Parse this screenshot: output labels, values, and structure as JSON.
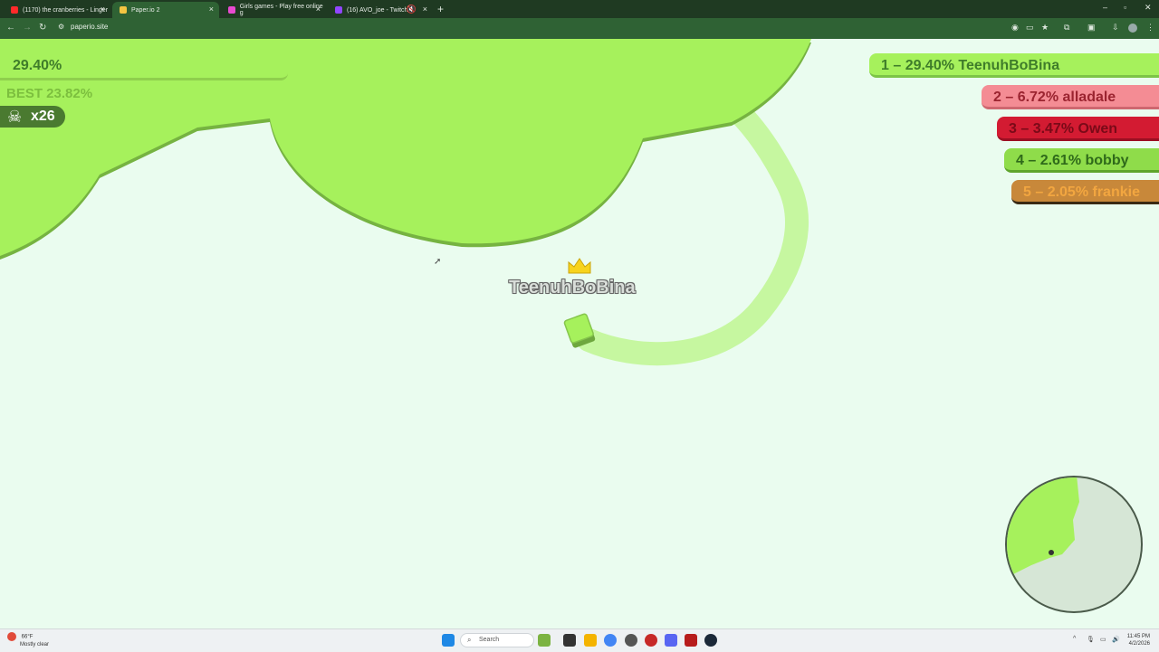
{
  "browser": {
    "tabs": [
      {
        "title": "(1170) the cranberries - Linger",
        "color": "#ff2a2a"
      },
      {
        "title": "Paper.io 2",
        "color": "#f4c542",
        "active": true
      },
      {
        "title": "Girls games - Play free online g",
        "color": "#e84ad1"
      },
      {
        "title": "(16) AVO_joe - Twitch",
        "color": "#9146ff"
      }
    ],
    "new_tab": "+",
    "url": "paperio.site"
  },
  "hud": {
    "percent": "29.40%",
    "best": "BEST 23.82%",
    "kills": "x26"
  },
  "leaderboard": [
    {
      "rank_text": "1 – 29.40% TeenuhBoBina",
      "bg": "#a6f15c",
      "border": "#7cc447",
      "fg": "#3f7d2a"
    },
    {
      "rank_text": "2 – 6.72% alladale",
      "bg": "#f48c94",
      "border": "#cf6770",
      "fg": "#9b2430"
    },
    {
      "rank_text": "3 – 3.47% Owen",
      "bg": "#d31b32",
      "border": "#9b0f22",
      "fg": "#7a0a18"
    },
    {
      "rank_text": "4 – 2.61% bobby",
      "bg": "#8fdc4a",
      "border": "#5fa52c",
      "fg": "#2f6a1a"
    },
    {
      "rank_text": "5 – 2.05% frankie",
      "bg": "#c8883a",
      "border": "#3a2a14",
      "fg": "#f2a640"
    }
  ],
  "player": {
    "name": "TeenuhBoBina",
    "color": "#a6f15c",
    "trail_color": "#c6f7a0",
    "shadow_color": "#7fb14a"
  },
  "taskbar": {
    "weather_temp": "66°F",
    "weather_desc": "Mostly clear",
    "search_placeholder": "Search",
    "time": "11:45 PM",
    "date": "4/2/2026"
  }
}
